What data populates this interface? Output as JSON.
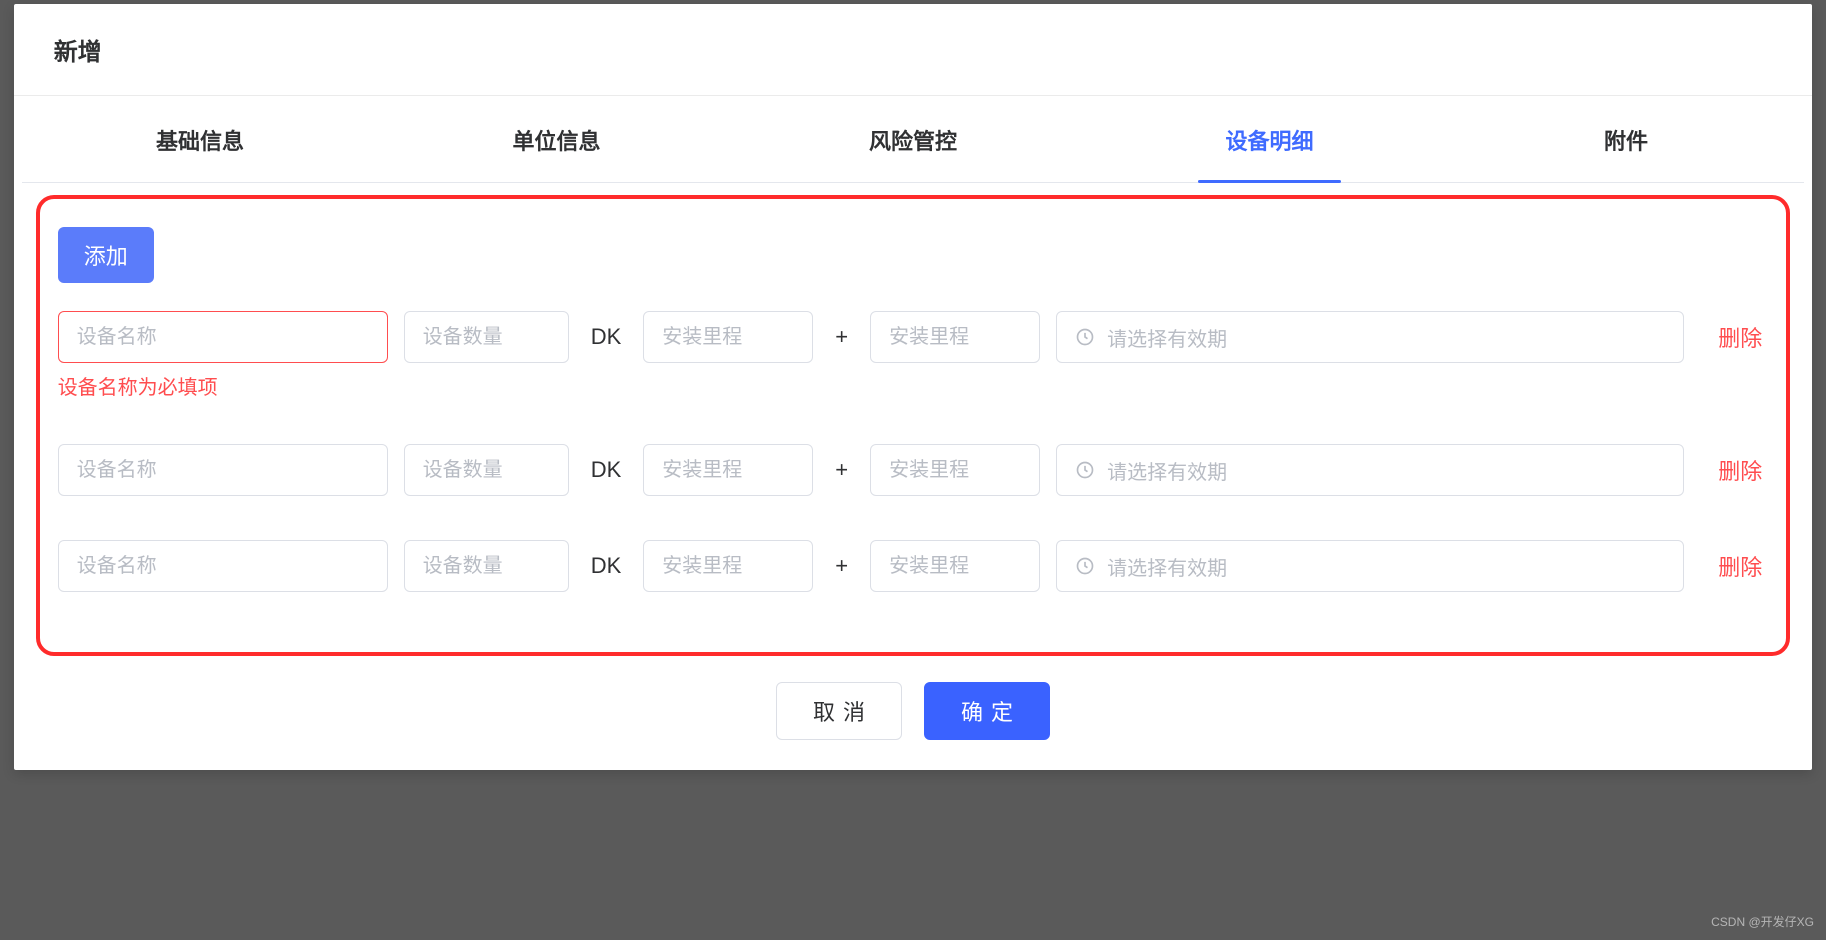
{
  "modal": {
    "title": "新增"
  },
  "tabs": [
    {
      "label": "基础信息",
      "active": false
    },
    {
      "label": "单位信息",
      "active": false
    },
    {
      "label": "风险管控",
      "active": false
    },
    {
      "label": "设备明细",
      "active": true
    },
    {
      "label": "附件",
      "active": false
    }
  ],
  "content": {
    "add_label": "添加",
    "error_text": "设备名称为必填项",
    "dk_label": "DK",
    "plus_label": "+",
    "delete_label": "删除",
    "placeholders": {
      "name": "设备名称",
      "qty": "设备数量",
      "mile": "安装里程",
      "date": "请选择有效期"
    },
    "rows": [
      {
        "name": "",
        "qty": "",
        "mile_a": "",
        "mile_b": "",
        "date": "",
        "has_error": true
      },
      {
        "name": "",
        "qty": "",
        "mile_a": "",
        "mile_b": "",
        "date": "",
        "has_error": false
      },
      {
        "name": "",
        "qty": "",
        "mile_a": "",
        "mile_b": "",
        "date": "",
        "has_error": false
      }
    ]
  },
  "footer": {
    "cancel_label": "取消",
    "confirm_label": "确定"
  },
  "watermark": "CSDN @开发仔XG"
}
